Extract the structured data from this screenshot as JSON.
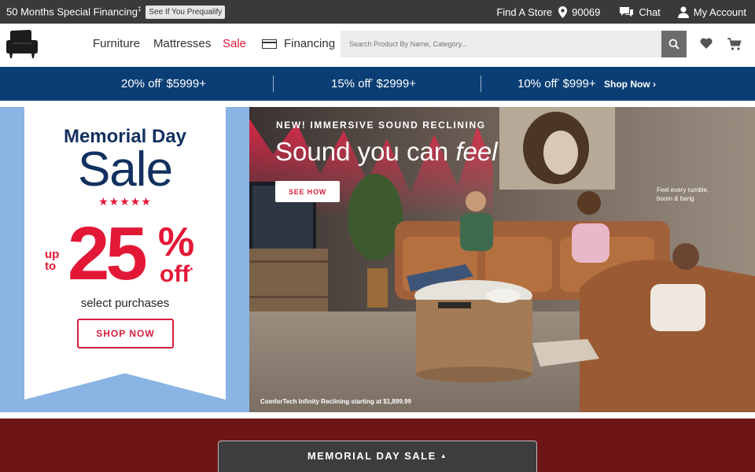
{
  "topbar": {
    "promo_text": "50 Months Special Financing",
    "promo_mark": "‡",
    "prequal_label": "See If You Prequalify",
    "find_store": "Find A Store",
    "zip": "90069",
    "chat": "Chat",
    "account": "My Account"
  },
  "nav": {
    "links": [
      "Furniture",
      "Mattresses",
      "Sale",
      "Financing"
    ],
    "search_placeholder": "Search Product By Name, Category..."
  },
  "strip": {
    "offers": [
      {
        "pct": "20% off",
        "mark": "*",
        "threshold": "$5999+"
      },
      {
        "pct": "15% off",
        "mark": "*",
        "threshold": "$2999+"
      },
      {
        "pct": "10% off",
        "mark": "*",
        "threshold": "$999+"
      }
    ],
    "shop_now": "Shop Now ›"
  },
  "hero_left": {
    "title": "Memorial Day",
    "sale": "Sale",
    "stars": "★★★★★",
    "up_to": "up to",
    "number": "25",
    "pct": "%",
    "off": "off",
    "off_mark": "*",
    "subtitle": "select purchases",
    "button": "SHOP NOW"
  },
  "hero_right": {
    "eyebrow": "NEW! IMMERSIVE SOUND RECLINING",
    "headline_prefix": "Sound you can ",
    "headline_em": "feel",
    "button": "SEE HOW",
    "note": "Feel every rumble, boom & bang",
    "caption": "ComforTech Infinity Reclining starting at $1,899.99"
  },
  "sticky": {
    "label": "MEMORIAL DAY SALE",
    "caret": "▲"
  },
  "colors": {
    "topbar_bg": "#3a3a3a",
    "strip_bg": "#0a3e75",
    "sale_red": "#e31837",
    "title_navy": "#12305f",
    "hero_left_bg": "#8ab4e3",
    "bottom_band": "#6e1516"
  },
  "icons": [
    "location-pin-icon",
    "chat-bubble-icon",
    "user-icon",
    "armchair-logo-icon",
    "card-icon",
    "search-icon",
    "heart-icon",
    "cart-icon"
  ]
}
